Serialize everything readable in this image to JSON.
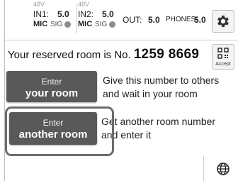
{
  "status_bar": {
    "in1": {
      "power": "48V",
      "name": "IN1:",
      "value": "5.0",
      "mic": "MIC",
      "sig": "SIG"
    },
    "in2": {
      "power": "48V",
      "name": "IN2:",
      "value": "5.0",
      "mic": "MIC",
      "sig": "SIG"
    },
    "out": {
      "name": "OUT:",
      "value": "5.0"
    },
    "phones": {
      "name": "PHONES:",
      "value": "5.0"
    },
    "settings_icon": "gear-icon"
  },
  "room": {
    "prefix": "Your reserved room is No.",
    "number": "1259 8669",
    "accept_label": "Accept",
    "accept_icon": "qr-code-icon"
  },
  "enter_your_room": {
    "line1": "Enter",
    "line2": "your room",
    "desc_line1": "Give this number to others",
    "desc_line2": "and wait in your room"
  },
  "enter_another_room": {
    "line1": "Enter",
    "line2": "another room",
    "desc_line1": "Get another room number",
    "desc_line2": "and enter it"
  },
  "footer": {
    "language_icon": "globe-icon"
  },
  "colors": {
    "button_bg": "#595959",
    "ring": "#6c6c6c",
    "signal_dot": "#8c8c8c"
  }
}
